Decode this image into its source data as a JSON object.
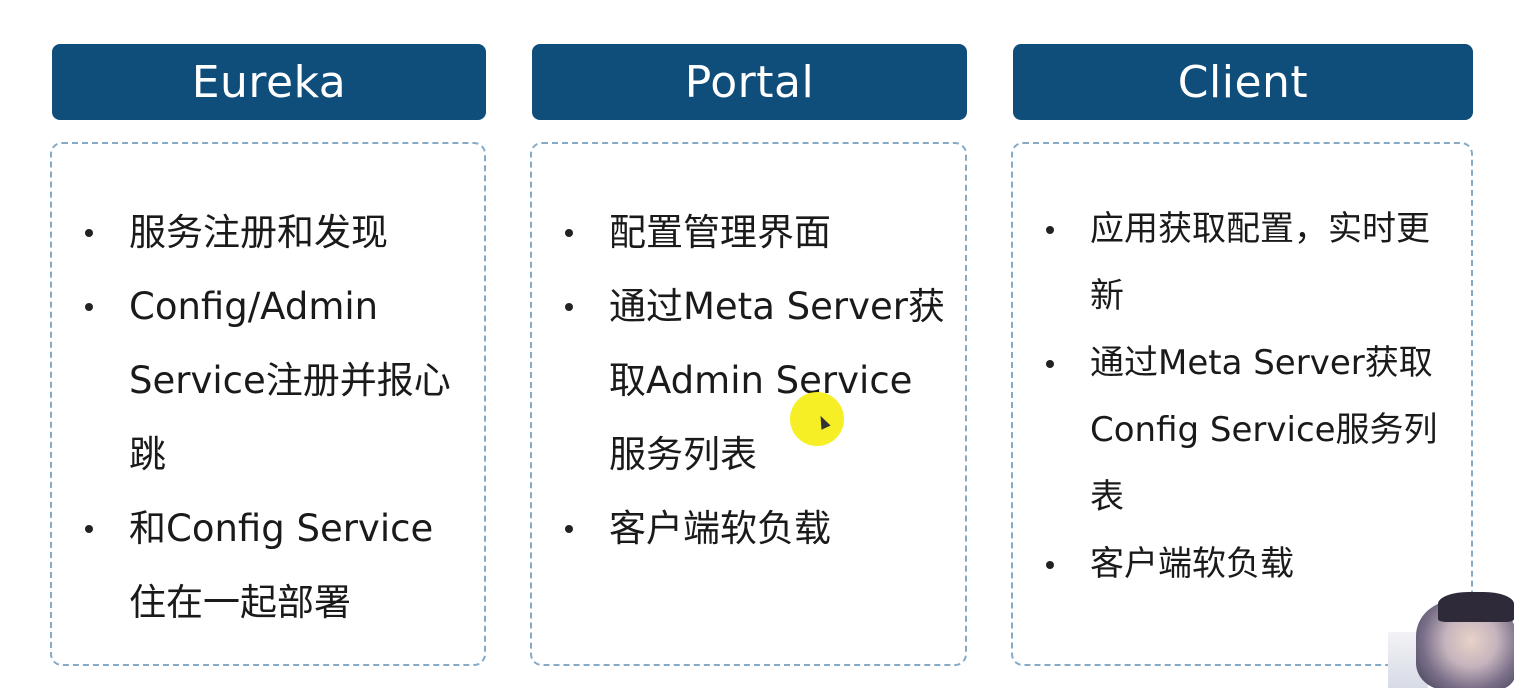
{
  "columns": [
    {
      "title": "Eureka",
      "bullets": [
        "服务注册和发现",
        "Config/Admin Service注册并报心跳",
        "和Config Service住在一起部署"
      ]
    },
    {
      "title": "Portal",
      "bullets": [
        "配置管理界面",
        "通过Meta Server获取Admin Service服务列表",
        "客户端软负载"
      ]
    },
    {
      "title": "Client",
      "bullets": [
        "应用获取配置，实时更新",
        "通过Meta Server获取Config Service服务列表",
        "客户端软负载"
      ]
    }
  ],
  "colors": {
    "header_background": "#0f4d7b",
    "header_text": "#ffffff",
    "box_border": "#86aac6",
    "body_text": "#1a1a1a",
    "cursor_highlight": "#f5ee14"
  },
  "icons": {
    "bullet": "bullet-dot",
    "cursor": "mouse-cursor-icon"
  }
}
